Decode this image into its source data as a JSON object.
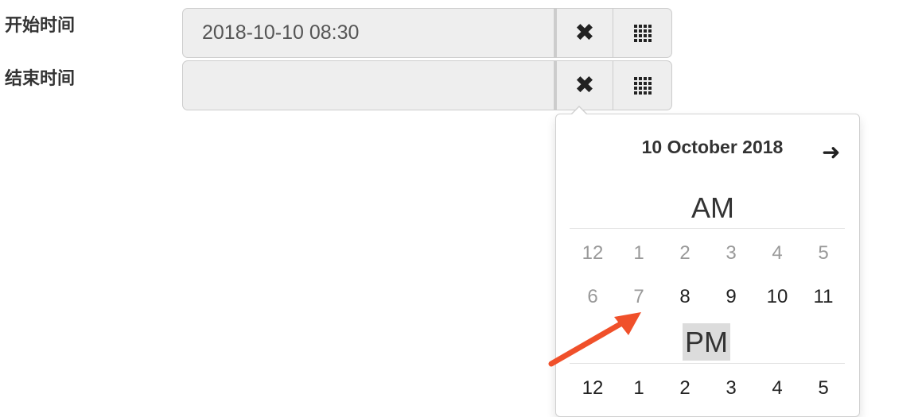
{
  "form": {
    "start": {
      "label": "开始时间",
      "value": "2018-10-10 08:30",
      "clear_icon": "close-icon",
      "picker_icon": "calendar-grid-icon"
    },
    "end": {
      "label": "结束时间",
      "value": "",
      "clear_icon": "close-icon",
      "picker_icon": "calendar-grid-icon"
    }
  },
  "picker": {
    "title": "10 October 2018",
    "next_icon": "arrow-right-icon",
    "am_label": "AM",
    "pm_label": "PM",
    "am_hours": [
      {
        "label": "12",
        "disabled": true
      },
      {
        "label": "1",
        "disabled": true
      },
      {
        "label": "2",
        "disabled": true
      },
      {
        "label": "3",
        "disabled": true
      },
      {
        "label": "4",
        "disabled": true
      },
      {
        "label": "5",
        "disabled": true
      },
      {
        "label": "6",
        "disabled": true
      },
      {
        "label": "7",
        "disabled": true
      },
      {
        "label": "8",
        "disabled": false
      },
      {
        "label": "9",
        "disabled": false
      },
      {
        "label": "10",
        "disabled": false
      },
      {
        "label": "11",
        "disabled": false
      }
    ],
    "pm_hours": [
      {
        "label": "12",
        "disabled": false
      },
      {
        "label": "1",
        "disabled": false
      },
      {
        "label": "2",
        "disabled": false
      },
      {
        "label": "3",
        "disabled": false
      },
      {
        "label": "4",
        "disabled": false
      },
      {
        "label": "5",
        "disabled": false
      }
    ]
  },
  "annotation": {
    "arrow_color": "#f0502a"
  }
}
